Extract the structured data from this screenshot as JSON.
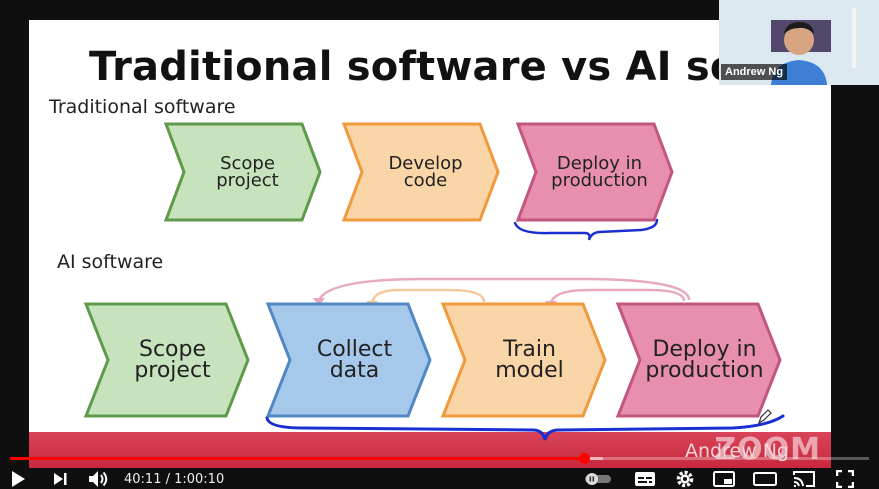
{
  "slide": {
    "title": "Traditional software vs AI softwa",
    "traditional_label": "Traditional software",
    "ai_label": "AI software",
    "traditional_steps": [
      {
        "line1": "Scope",
        "line2": "project",
        "color": "#c7e3bd",
        "stroke": "#5f9a4a"
      },
      {
        "line1": "Develop",
        "line2": "code",
        "color": "#fad5a8",
        "stroke": "#ee9a3d"
      },
      {
        "line1": "Deploy in",
        "line2": "production",
        "color": "#e88fb0",
        "stroke": "#c25680"
      }
    ],
    "ai_steps": [
      {
        "line1": "Scope",
        "line2": "project",
        "color": "#c7e3bd",
        "stroke": "#5f9a4a"
      },
      {
        "line1": "Collect",
        "line2": "data",
        "color": "#a6c8ea",
        "stroke": "#4f88c4"
      },
      {
        "line1": "Train",
        "line2": "model",
        "color": "#fad5a8",
        "stroke": "#ee9a3d"
      },
      {
        "line1": "Deploy in",
        "line2": "production",
        "color": "#e88fb0",
        "stroke": "#c25680"
      }
    ],
    "zoom_watermark_name": "Andrew Ng",
    "zoom_logo": "ZOOM"
  },
  "webcam": {
    "speaker_name": "Andrew Ng"
  },
  "player": {
    "current_time": "40:11",
    "duration": "1:00:10",
    "time_text": "40:11 / 1:00:10",
    "progress_fraction": 0.668,
    "buffered_fraction": 0.69,
    "icons": [
      "play-icon",
      "next-icon",
      "volume-icon",
      "autoplay-toggle-icon",
      "subtitles-icon",
      "settings-icon",
      "miniplayer-icon",
      "theater-icon",
      "cast-icon",
      "fullscreen-icon"
    ],
    "accent_color": "#ff0000"
  }
}
